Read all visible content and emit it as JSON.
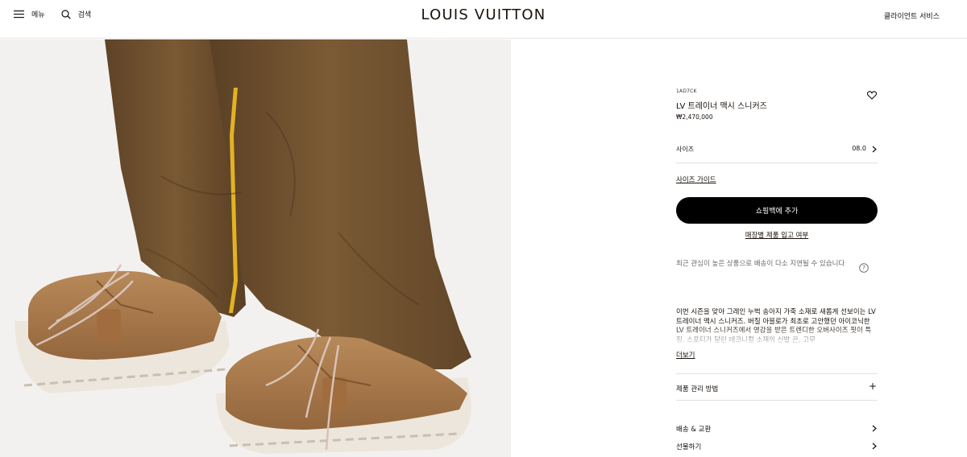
{
  "header": {
    "menu_label": "메뉴",
    "search_label": "검색",
    "brand": "LOUIS VUITTON",
    "client_service": "클라이언트 서비스"
  },
  "product": {
    "sku": "1AD7CK",
    "name": "LV 트레이너 맥시 스니커즈",
    "price": "₩2,470,000",
    "size_label": "사이즈",
    "size_value": "08.0",
    "size_guide": "사이즈 가이드",
    "add_to_bag": "쇼핑백에 추가",
    "store_stock": "매장별 제품 입고 여부",
    "notice": "최근 관심이 높은 상품으로 배송이 다소 지연될 수 있습니다",
    "description": "이번 시즌을 맞아 그레인 누벅 송아지 가죽 소재로 새롭게 선보이는 LV 트레이너 맥시 스니커즈. 버질 아블로가 최초로 고안했던 아이코닉한 LV 트레이너 스니커즈에서 영감을 받은 트렌디한 오버사이즈 핏이 특징. 스포티가 달린 테크니컬 소재의 신발 끈, 고무",
    "read_more": "더보기",
    "care_label": "제품 관리 방법",
    "shipping_label": "배송 & 교환",
    "gift_label": "선물하기"
  },
  "colors": {
    "text": "#19110b",
    "button_bg": "#000000",
    "pants": "#6e4f2e",
    "shoe": "#a9784a",
    "sole": "#ede6dc",
    "stripe": "#e3b223"
  },
  "icons": [
    "menu-icon",
    "search-icon",
    "heart-icon",
    "chevron-right-icon",
    "question-icon",
    "plus-icon"
  ]
}
